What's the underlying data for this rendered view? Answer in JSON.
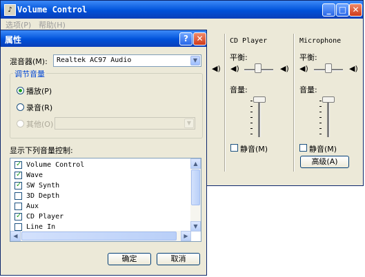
{
  "main_window": {
    "title": "Volume Control",
    "menu": [
      "选项(P)",
      "帮助(H)"
    ],
    "channels": [
      {
        "name": "CD Player",
        "balance_label": "平衡:",
        "volume_label": "音量:",
        "mute_label": "静音(M)",
        "muted": false
      },
      {
        "name": "Microphone",
        "balance_label": "平衡:",
        "volume_label": "音量:",
        "mute_label": "静音(M)",
        "muted": false,
        "advanced_label": "高级(A)"
      }
    ]
  },
  "dialog": {
    "title": "属性",
    "mixer_label": "混音器(M):",
    "mixer_value": "Realtek AC97 Audio",
    "adjust_group": "调节音量",
    "radios": [
      {
        "label": "播放(P)",
        "selected": true,
        "disabled": false
      },
      {
        "label": "录音(R)",
        "selected": false,
        "disabled": false
      },
      {
        "label": "其他(O)",
        "selected": false,
        "disabled": true
      }
    ],
    "list_label": "显示下列音量控制:",
    "controls": [
      {
        "label": "Volume Control",
        "checked": true
      },
      {
        "label": "Wave",
        "checked": true
      },
      {
        "label": "SW Synth",
        "checked": true
      },
      {
        "label": "3D Depth",
        "checked": false
      },
      {
        "label": "Aux",
        "checked": false
      },
      {
        "label": "CD Player",
        "checked": true
      },
      {
        "label": "Line In",
        "checked": false
      }
    ],
    "ok_label": "确定",
    "cancel_label": "取消"
  },
  "colors": {
    "titlebar": "#0a5ce0",
    "face": "#ece9d8",
    "accent": "#0046d5",
    "check": "#21a121"
  }
}
